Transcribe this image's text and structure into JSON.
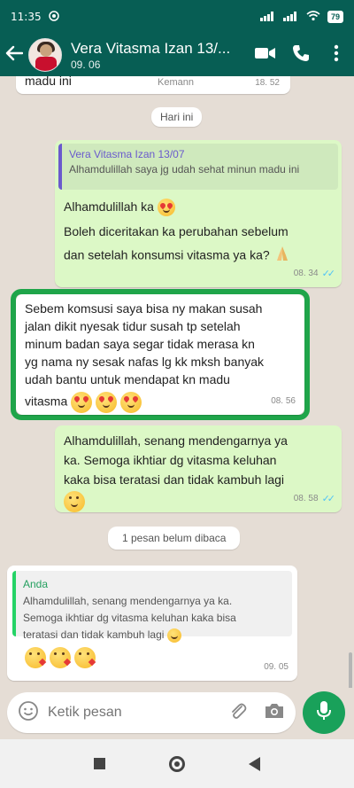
{
  "status_bar": {
    "time": "11:35",
    "battery": "79"
  },
  "header": {
    "back_icon": "arrow-left",
    "title": "Vera Vitasma Izan 13/...",
    "subtitle": "09. 06"
  },
  "top_partial": {
    "text": "madu ini",
    "sender": "Kemann",
    "time": "18. 52"
  },
  "date_pill": "Hari ini",
  "msg1": {
    "quote_name": "Vera Vitasma Izan 13/07",
    "quote_text": "Alhamdulillah saya jg udah sehat minun madu ini",
    "line1": "Alhamdulillah ka",
    "line2": "Boleh diceritakan ka perubahan sebelum",
    "line3": "dan setelah konsumsi vitasma ya ka?",
    "time": "08. 34"
  },
  "msg2": {
    "lines": [
      "Sebem komsusi saya bisa ny makan susah",
      "jalan dikit nyesak tidur susah tp setelah",
      "minum badan saya segar tidak merasa kn",
      "yg nama ny sesak nafas lg kk mksh banyak",
      "udah bantu untuk mendapat kn madu",
      "vitasma"
    ],
    "time": "08. 56"
  },
  "msg3": {
    "lines": [
      "Alhamdulillah,  senang mendengarnya ya",
      "ka.  Semoga ikhtiar dg vitasma keluhan",
      "kaka bisa teratasi dan tidak kambuh lagi"
    ],
    "time": "08. 58"
  },
  "unread_pill": "1 pesan belum dibaca",
  "msg4": {
    "quote_name": "Anda",
    "quote_lines": [
      "Alhamdulillah,  senang mendengarnya ya ka.",
      "Semoga ikhtiar dg vitasma keluhan kaka bisa",
      "teratasi dan tidak kambuh lagi"
    ],
    "time": "09. 05"
  },
  "input": {
    "placeholder": "Ketik pesan"
  },
  "colors": {
    "header": "#075e54",
    "outgoing": "#dcf8c6",
    "frame": "#1fa54a",
    "mic": "#19a15a"
  }
}
